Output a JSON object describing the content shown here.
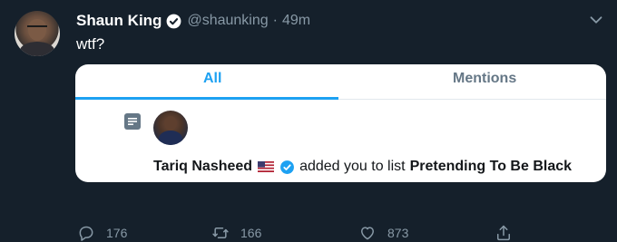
{
  "tweet": {
    "author_name": "Shaun King",
    "handle": "@shaunking",
    "separator": "·",
    "time": "49m",
    "text": "wtf?",
    "verified": true
  },
  "card": {
    "tabs": [
      "All",
      "Mentions"
    ],
    "active_tab": "All",
    "notification": {
      "actor_name": "Tariq Nasheed",
      "actor_flag": "us-flag",
      "actor_verified": true,
      "action_text": "added you to list",
      "list_name": "Pretending To Be Black",
      "icon": "list-icon"
    }
  },
  "actions": {
    "reply_count": "176",
    "retweet_count": "166",
    "like_count": "873"
  },
  "colors": {
    "background": "#15202b",
    "accent": "#1da1f2",
    "muted": "#8899a6"
  }
}
